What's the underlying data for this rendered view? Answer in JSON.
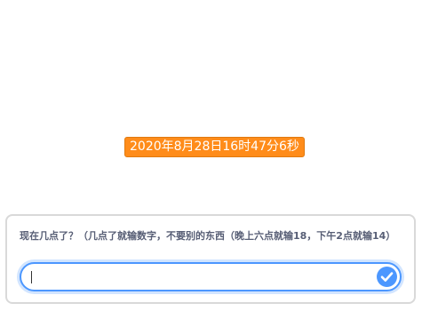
{
  "stage": {
    "say_text": "2020年8月28日16时47分6秒"
  },
  "ask": {
    "question": "现在几点了？（几点了就输数字，不要别的东西（晚上六点就输18，下午2点就输14）",
    "input_value": "",
    "submit_icon": "checkmark-icon"
  },
  "colors": {
    "say_bubble": "#ff8c1a",
    "accent": "#4c97ff",
    "question_text": "#575e75"
  }
}
